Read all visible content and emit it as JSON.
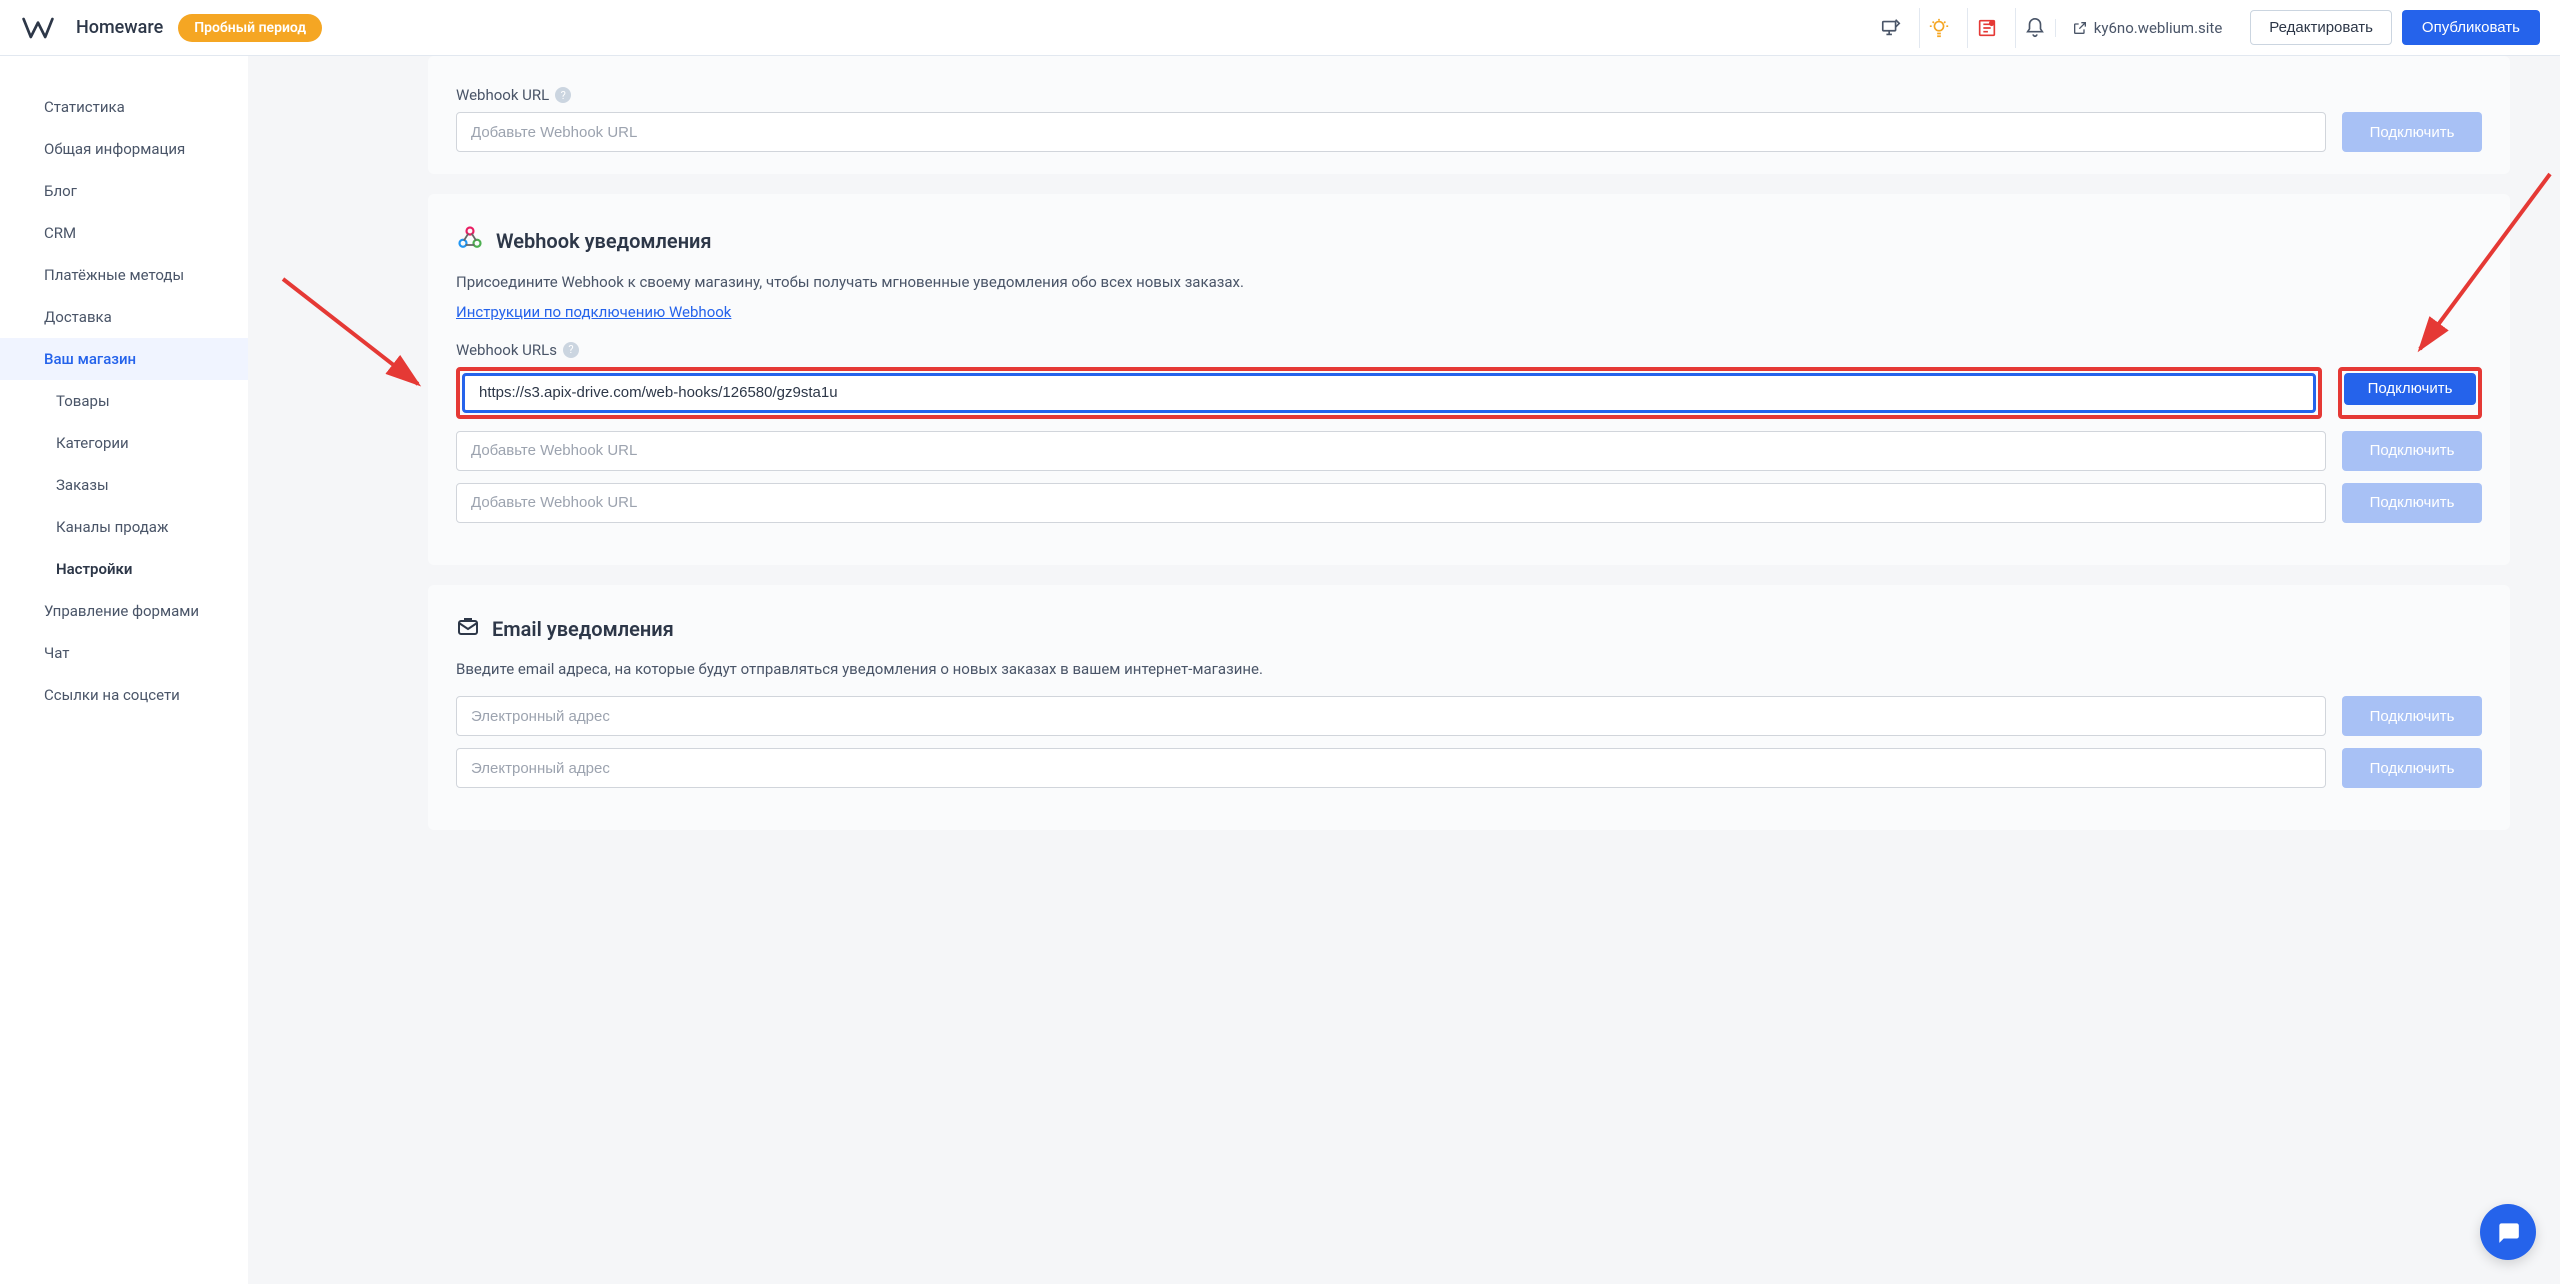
{
  "header": {
    "site_name": "Homeware",
    "trial_label": "Пробный период",
    "site_url": "ky6no.weblium.site",
    "edit_button": "Редактировать",
    "publish_button": "Опубликовать"
  },
  "sidebar": {
    "items": [
      {
        "label": "Статистика"
      },
      {
        "label": "Общая информация"
      },
      {
        "label": "Блог"
      },
      {
        "label": "CRM"
      },
      {
        "label": "Платёжные методы"
      },
      {
        "label": "Доставка"
      },
      {
        "label": "Ваш магазин",
        "active": true
      },
      {
        "label": "Управление формами"
      },
      {
        "label": "Чат"
      },
      {
        "label": "Ссылки на соцсети"
      }
    ],
    "subitems": [
      {
        "label": "Товары"
      },
      {
        "label": "Категории"
      },
      {
        "label": "Заказы"
      },
      {
        "label": "Каналы продаж"
      },
      {
        "label": "Настройки",
        "bold": true
      }
    ]
  },
  "section_top": {
    "field_label": "Webhook URL",
    "placeholder": "Добавьте Webhook URL",
    "connect": "Подключить"
  },
  "section_webhook": {
    "title": "Webhook уведомления",
    "description": "Присоедините Webhook к своему магазину, чтобы получать мгновенные уведомления обо всех новых заказах.",
    "link": "Инструкции по подключению Webhook",
    "field_label": "Webhook URLs",
    "url_value": "https://s3.apix-drive.com/web-hooks/126580/gz9sta1u",
    "placeholder": "Добавьте Webhook URL",
    "connect": "Подключить"
  },
  "section_email": {
    "title": "Email уведомления",
    "description": "Введите email адреса, на которые будут отправляться уведомления о новых заказах в вашем интернет-магазине.",
    "placeholder": "Электронный адрес",
    "connect": "Подключить"
  }
}
